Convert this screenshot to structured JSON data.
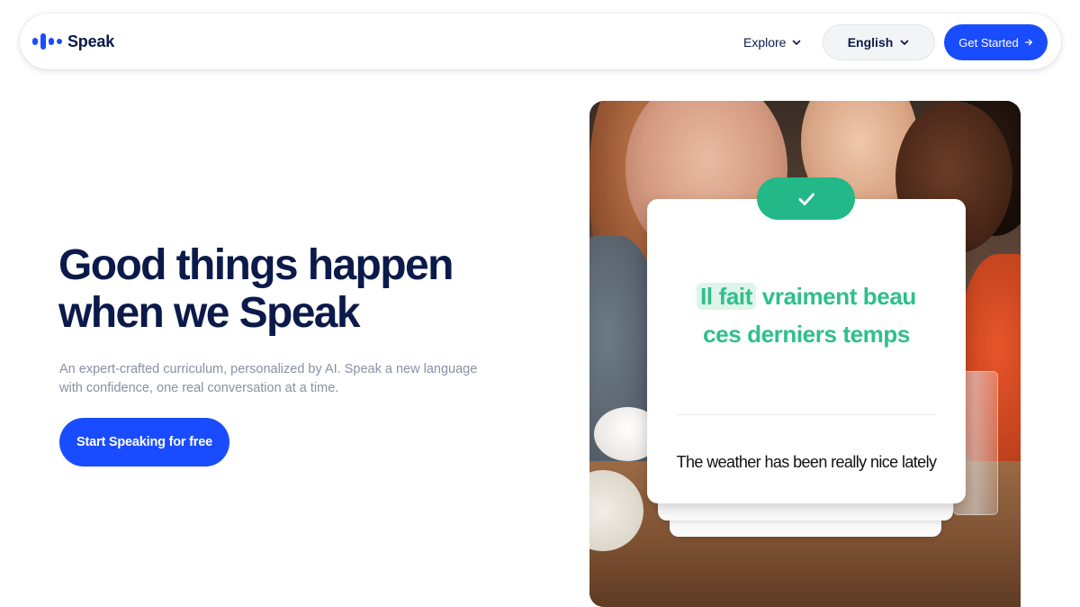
{
  "brand": {
    "name": "Speak"
  },
  "nav": {
    "explore_label": "Explore",
    "language_label": "English",
    "cta_label": "Get Started"
  },
  "hero": {
    "title_line1": "Good things happen",
    "title_line2": "when we Speak",
    "subtitle": "An expert-crafted curriculum, personalized by AI. Speak a new language with confidence, one real conversation at a time.",
    "cta_label": "Start Speaking for free"
  },
  "card": {
    "phrase_highlight": "Il fait",
    "phrase_rest_line1": "vraiment beau",
    "phrase_line2": "ces derniers temps",
    "translation": "The weather has been really nice lately"
  },
  "colors": {
    "brand_blue": "#1a4cff",
    "navy": "#0b1a4a",
    "success_green": "#22b888",
    "phrase_green": "#2ec08a"
  },
  "icons": {
    "explore": "chevron-down-icon",
    "language": "chevron-down-icon",
    "cta": "arrow-right-icon",
    "card": "checkmark-icon"
  }
}
